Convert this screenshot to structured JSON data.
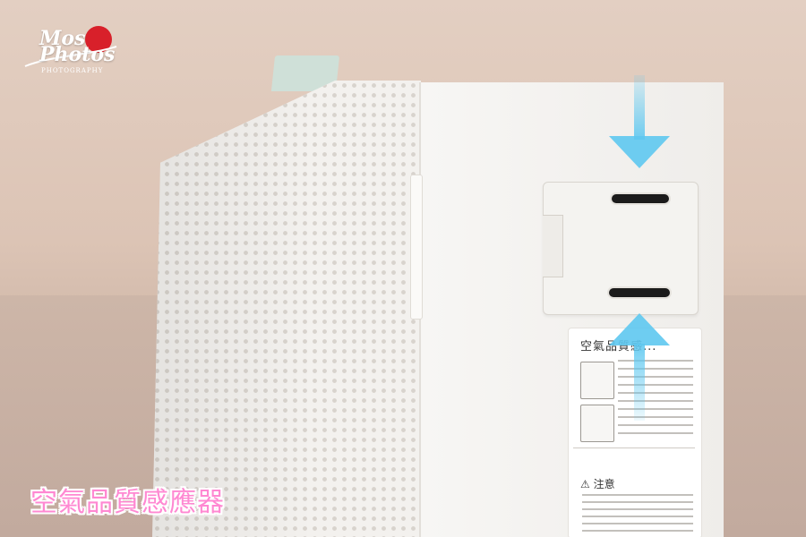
{
  "watermark": {
    "line1": "Mos",
    "line2": "Photos",
    "sub": "PHOTOGRAPHY"
  },
  "device_label": {
    "title": "空氣品質感...",
    "note_title": "注意"
  },
  "caption": "空氣品質感應器",
  "colors": {
    "arrow": "#5ec8f0",
    "caption": "#ff88d2",
    "watermark_sun": "#d8202a"
  },
  "icons": {
    "arrows": "arrow-down-icon, arrow-up-icon",
    "warning": "warning-icon"
  }
}
